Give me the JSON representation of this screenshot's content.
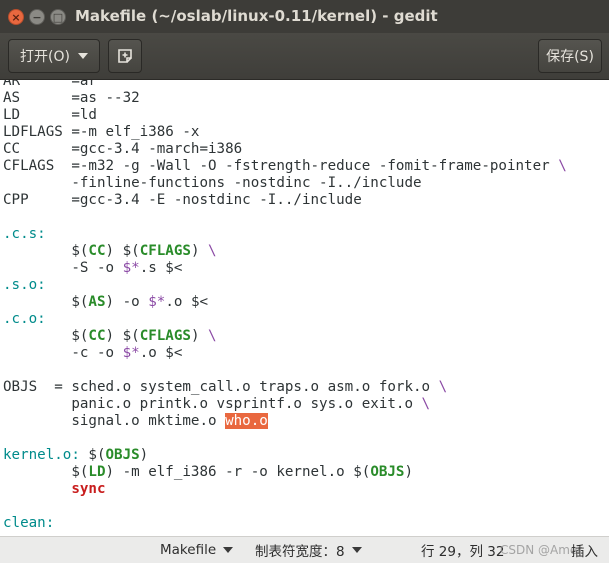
{
  "window": {
    "title": "Makefile (~/oslab/linux-0.11/kernel) - gedit",
    "close_glyph": "×",
    "min_glyph": "−",
    "max_glyph": "□"
  },
  "header": {
    "open_label": "打开(O)",
    "new_tab_icon": "new-document-icon",
    "save_label": "保存(S)"
  },
  "code_lines": [
    [
      {
        "t": "AR      =ar"
      }
    ],
    [
      {
        "t": "AS      =as --32"
      }
    ],
    [
      {
        "t": "LD      =ld"
      }
    ],
    [
      {
        "t": "LDFLAGS =-m elf_i386 -x"
      }
    ],
    [
      {
        "t": "CC      =gcc-3.4 -march=i386"
      }
    ],
    [
      {
        "t": "CFLAGS  =-m32 -g -Wall -O -fstrength-reduce -fomit-frame-pointer "
      },
      {
        "t": "\\",
        "c": "kw-sym"
      }
    ],
    [
      {
        "t": "        -finline-functions -nostdinc -I../include"
      }
    ],
    [
      {
        "t": "CPP     =gcc-3.4 -E -nostdinc -I../include"
      }
    ],
    [
      {
        "t": ""
      }
    ],
    [
      {
        "t": ".c.s:",
        "c": "kw-target"
      }
    ],
    [
      {
        "t": "        $("
      },
      {
        "t": "CC",
        "c": "kw-var"
      },
      {
        "t": ") $("
      },
      {
        "t": "CFLAGS",
        "c": "kw-var"
      },
      {
        "t": ") "
      },
      {
        "t": "\\",
        "c": "kw-sym"
      }
    ],
    [
      {
        "t": "        -S -o "
      },
      {
        "t": "$*",
        "c": "kw-sym"
      },
      {
        "t": ".s $<"
      }
    ],
    [
      {
        "t": ".s.o:",
        "c": "kw-target"
      }
    ],
    [
      {
        "t": "        $("
      },
      {
        "t": "AS",
        "c": "kw-var"
      },
      {
        "t": ") -o "
      },
      {
        "t": "$*",
        "c": "kw-sym"
      },
      {
        "t": ".o $<"
      }
    ],
    [
      {
        "t": ".c.o:",
        "c": "kw-target"
      }
    ],
    [
      {
        "t": "        $("
      },
      {
        "t": "CC",
        "c": "kw-var"
      },
      {
        "t": ") $("
      },
      {
        "t": "CFLAGS",
        "c": "kw-var"
      },
      {
        "t": ") "
      },
      {
        "t": "\\",
        "c": "kw-sym"
      }
    ],
    [
      {
        "t": "        -c -o "
      },
      {
        "t": "$*",
        "c": "kw-sym"
      },
      {
        "t": ".o $<"
      }
    ],
    [
      {
        "t": ""
      }
    ],
    [
      {
        "t": "OBJS  = sched.o system_call.o traps.o asm.o fork.o "
      },
      {
        "t": "\\",
        "c": "kw-sym"
      }
    ],
    [
      {
        "t": "        panic.o printk.o vsprintf.o sys.o exit.o "
      },
      {
        "t": "\\",
        "c": "kw-sym"
      }
    ],
    [
      {
        "t": "        signal.o mktime.o "
      },
      {
        "t": "who.o",
        "c": "hl"
      }
    ],
    [
      {
        "t": ""
      }
    ],
    [
      {
        "t": "kernel.o:",
        "c": "kw-target"
      },
      {
        "t": " $("
      },
      {
        "t": "OBJS",
        "c": "kw-var"
      },
      {
        "t": ")"
      }
    ],
    [
      {
        "t": "        $("
      },
      {
        "t": "LD",
        "c": "kw-var"
      },
      {
        "t": ") -m elf_i386 -r -o kernel.o $("
      },
      {
        "t": "OBJS",
        "c": "kw-var"
      },
      {
        "t": ")"
      }
    ],
    [
      {
        "t": "        "
      },
      {
        "t": "sync",
        "c": "kw-red"
      }
    ],
    [
      {
        "t": ""
      }
    ],
    [
      {
        "t": "clean:",
        "c": "kw-target"
      }
    ]
  ],
  "statusbar": {
    "language": "Makefile",
    "tab_width": "制表符宽度：8",
    "position": "行 29，列 32",
    "mode": "插入",
    "watermark": "CSDN @Amer"
  }
}
